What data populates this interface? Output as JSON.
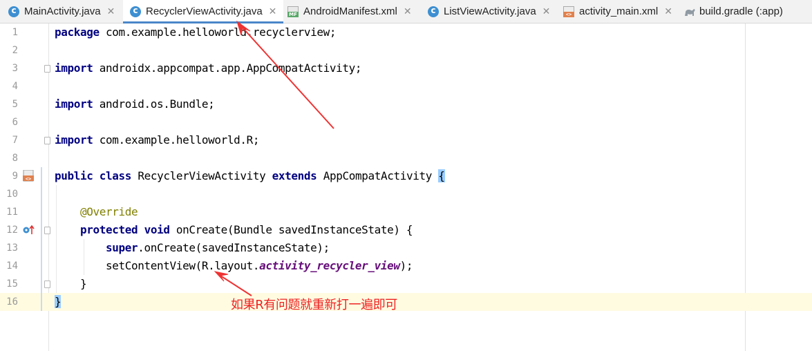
{
  "tabs": [
    {
      "label": "MainActivity.java",
      "icon": "class-icon",
      "active": false
    },
    {
      "label": "RecyclerViewActivity.java",
      "icon": "class-icon",
      "active": true
    },
    {
      "label": "AndroidManifest.xml",
      "icon": "manifest-icon",
      "active": false
    },
    {
      "label": "ListViewActivity.java",
      "icon": "class-icon",
      "active": false
    },
    {
      "label": "activity_main.xml",
      "icon": "layout-file-icon",
      "active": false
    },
    {
      "label": "build.gradle (:app)",
      "icon": "gradle-icon",
      "active": false
    }
  ],
  "tab_close_glyph": "✕",
  "line_numbers": [
    "1",
    "2",
    "3",
    "4",
    "5",
    "6",
    "7",
    "8",
    "9",
    "10",
    "11",
    "12",
    "13",
    "14",
    "15",
    "16"
  ],
  "code": {
    "l1": {
      "kw": "package",
      "rest": " com.example.helloworld.recyclerview;"
    },
    "l3": {
      "kw": "import",
      "rest": " androidx.appcompat.app.AppCompatActivity;"
    },
    "l5": {
      "kw": "import",
      "rest": " android.os.Bundle;"
    },
    "l7": {
      "kw": "import",
      "rest": " com.example.helloworld.R;"
    },
    "l9": {
      "kw1": "public",
      "kw2": "class",
      "name": "RecyclerViewActivity",
      "kw3": "extends",
      "parent": "AppCompatActivity",
      "brace": "{"
    },
    "l11": {
      "annotation": "@Override"
    },
    "l12": {
      "kw1": "protected",
      "kw2": "void",
      "rest": " onCreate(Bundle savedInstanceState) {"
    },
    "l13": {
      "kw": "super",
      "rest": ".onCreate(savedInstanceState);"
    },
    "l14": {
      "pre": "setContentView(R.layout.",
      "field": "activity_recycler_view",
      "post": ");"
    },
    "l15": {
      "text": "}"
    },
    "l16": {
      "text": "}"
    }
  },
  "gutter_icons": {
    "line9": "layout-file-icon",
    "line12": "override-icon"
  },
  "annotation_note": "如果R有问题就重新打一遍即可",
  "colors": {
    "keyword": "#000080",
    "annotation": "#808000",
    "field": "#660e7a",
    "brace_highlight": "#99ccff",
    "caret_row": "#fffbe1",
    "active_tab_underline": "#4a86c8",
    "annotation_red": "#ee2222"
  }
}
